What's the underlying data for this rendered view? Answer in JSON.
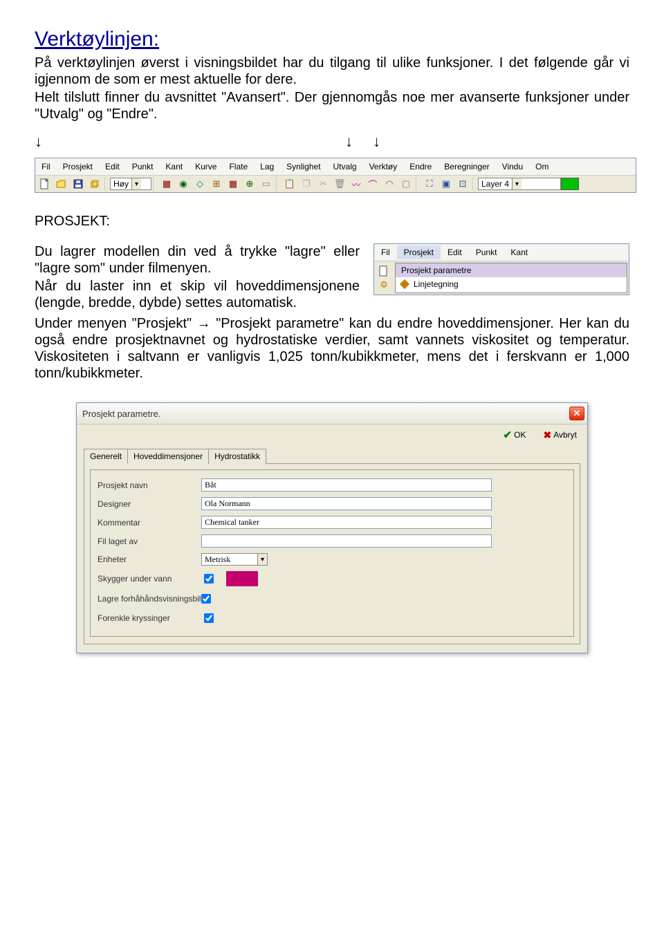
{
  "doc": {
    "title": "Verktøylinjen:",
    "intro": "På verktøylinjen øverst i visningsbildet har du tilgang til ulike funksjoner. I det følgende går vi igjennom de som er mest aktuelle for dere.",
    "intro2": "Helt tilslutt finner du avsnittet \"Avansert\". Der gjennomgås noe mer avanserte funksjoner under \"Utvalg\" og \"Endre\".",
    "arrow": "↓",
    "section2": "PROSJEKT:",
    "body2a": "Du lagrer modellen din ved å trykke \"lagre\" eller \"lagre som\" under filmenyen.",
    "body2b": "Når du laster inn et skip vil hoveddimensjonene (lengde, bredde, dybde) settes automatisk.",
    "body2c": "Under menyen \"Prosjekt\" → \"Prosjekt parametre\" kan du endre hoveddimensjoner. Her kan du også endre prosjektnavnet og hydrostatiske verdier, samt vannets viskositet og temperatur. Viskositeten i saltvann er vanligvis 1,025 tonn/kubikkmeter, mens det i ferskvann er 1,000 tonn/kubikkmeter."
  },
  "toolbar": {
    "menus": [
      "Fil",
      "Prosjekt",
      "Edit",
      "Punkt",
      "Kant",
      "Kurve",
      "Flate",
      "Lag",
      "Synlighet",
      "Utvalg",
      "Verktøy",
      "Endre",
      "Beregninger",
      "Vindu",
      "Om"
    ],
    "quality_value": "Høy",
    "layer_value": "Layer 4",
    "accent_color": "#00C000"
  },
  "mini": {
    "menus": [
      "Fil",
      "Prosjekt",
      "Edit",
      "Punkt",
      "Kant"
    ],
    "items": [
      "Prosjekt parametre",
      "Linjetegning"
    ]
  },
  "dialog": {
    "title": "Prosjekt parametre.",
    "ok": "OK",
    "cancel": "Avbryt",
    "tabs": [
      "Generelt",
      "Hoveddimensjoner",
      "Hydrostatikk"
    ],
    "fields": {
      "project_name_label": "Prosjekt navn",
      "project_name_value": "Båt",
      "designer_label": "Designer",
      "designer_value": "Ola Normann",
      "comment_label": "Kommentar",
      "comment_value": "Chemical tanker",
      "file_label": "Fil laget av",
      "file_value": "",
      "units_label": "Enheter",
      "units_value": "Metrisk",
      "shadow_label": "Skygger under vann",
      "preview_label": "Lagre forhåhåndsvisningsbilde",
      "simplify_label": "Forenkle kryssinger",
      "swatch_color": "#C3006B"
    }
  }
}
